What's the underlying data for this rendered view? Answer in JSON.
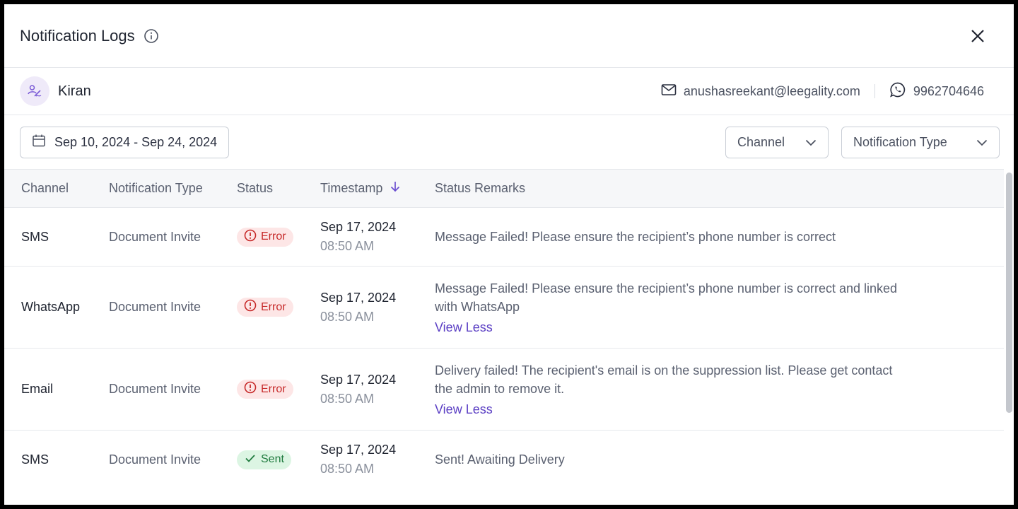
{
  "header": {
    "title": "Notification Logs",
    "info_icon": "info-icon",
    "close_icon": "close-icon"
  },
  "recipient": {
    "name": "Kiran",
    "email": "anushasreekant@leegality.com",
    "phone": "9962704646",
    "avatar_icon": "signer-icon"
  },
  "filters": {
    "date_range": "Sep 10, 2024 - Sep 24, 2024",
    "channel_label": "Channel",
    "type_label": "Notification Type"
  },
  "table": {
    "columns": [
      "Channel",
      "Notification Type",
      "Status",
      "Timestamp",
      "Status Remarks"
    ],
    "rows": [
      {
        "channel": "SMS",
        "type": "Document Invite",
        "status": "Error",
        "status_kind": "error",
        "date": "Sep 17, 2024",
        "time": "08:50 AM",
        "remark": "Message Failed! Please ensure the recipient’s phone number is correct",
        "link": ""
      },
      {
        "channel": "WhatsApp",
        "type": "Document Invite",
        "status": "Error",
        "status_kind": "error",
        "date": "Sep 17, 2024",
        "time": "08:50 AM",
        "remark": "Message Failed! Please ensure the recipient’s phone number is correct and linked with WhatsApp",
        "link": "View Less"
      },
      {
        "channel": "Email",
        "type": "Document Invite",
        "status": "Error",
        "status_kind": "error",
        "date": "Sep 17, 2024",
        "time": "08:50 AM",
        "remark": "Delivery failed! The recipient's email is on the suppression list. Please get contact the admin to remove it.",
        "link": "View Less"
      },
      {
        "channel": "SMS",
        "type": "Document Invite",
        "status": "Sent",
        "status_kind": "sent",
        "date": "Sep 17, 2024",
        "time": "08:50 AM",
        "remark": "Sent! Awaiting Delivery",
        "link": ""
      }
    ]
  },
  "colors": {
    "accent": "#5b3fc4",
    "error": "#c62828",
    "error_bg": "#fde6e6",
    "sent": "#1f7a3e",
    "sent_bg": "#dcf5e3"
  }
}
